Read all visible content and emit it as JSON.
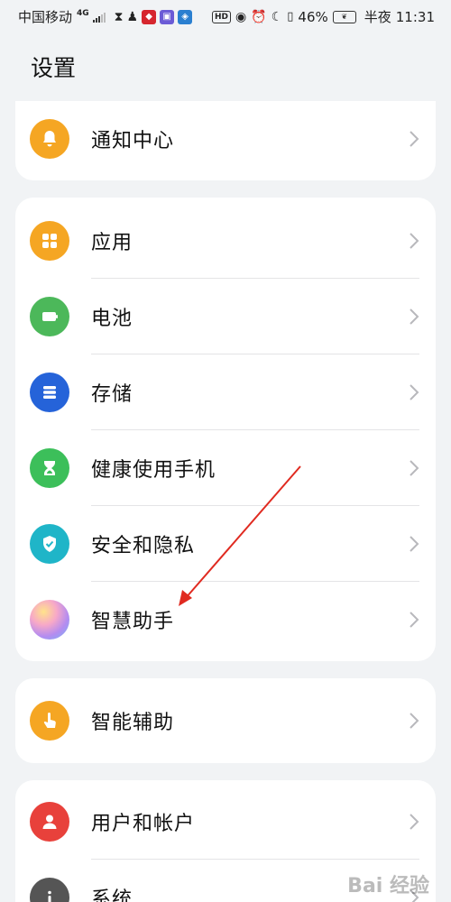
{
  "status_bar": {
    "carrier": "中国移动",
    "network": "4G",
    "battery_percent": "46%",
    "time_period": "半夜",
    "time": "11:31"
  },
  "page": {
    "title": "设置"
  },
  "groups": [
    {
      "items": [
        {
          "label": "通知中心",
          "icon": "bell-icon",
          "color": "#f5a623"
        }
      ]
    },
    {
      "items": [
        {
          "label": "应用",
          "icon": "apps-grid-icon",
          "color": "#f5a623"
        },
        {
          "label": "电池",
          "icon": "battery-icon",
          "color": "#4cb85a"
        },
        {
          "label": "存储",
          "icon": "storage-icon",
          "color": "#2563d9"
        },
        {
          "label": "健康使用手机",
          "icon": "hourglass-icon",
          "color": "#3cbf5a"
        },
        {
          "label": "安全和隐私",
          "icon": "shield-check-icon",
          "color": "#1fb5c8"
        },
        {
          "label": "智慧助手",
          "icon": "assistant-orb-icon",
          "color": "#c58fe0"
        }
      ]
    },
    {
      "items": [
        {
          "label": "智能辅助",
          "icon": "hand-tap-icon",
          "color": "#f5a623"
        }
      ]
    },
    {
      "items": [
        {
          "label": "用户和帐户",
          "icon": "user-icon",
          "color": "#e8413b"
        },
        {
          "label": "系统",
          "icon": "info-icon",
          "color": "#555555"
        }
      ]
    }
  ],
  "watermark": "Bai 经验"
}
